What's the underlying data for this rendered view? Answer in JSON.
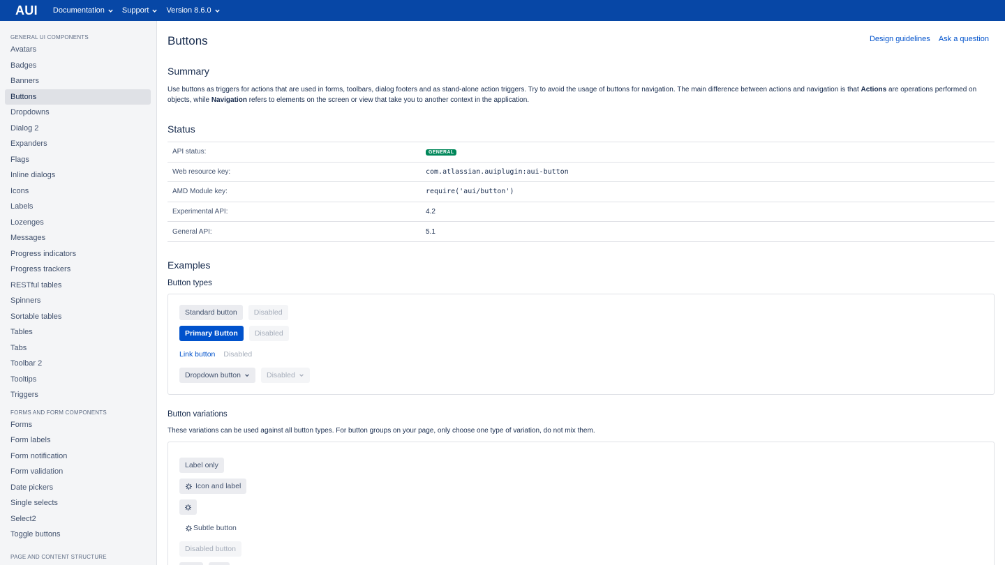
{
  "header": {
    "logo": "AUI",
    "nav": [
      {
        "label": "Documentation"
      },
      {
        "label": "Support"
      },
      {
        "label": "Version 8.6.0"
      }
    ]
  },
  "sidebar": {
    "sections": [
      {
        "heading": "GENERAL UI COMPONENTS",
        "items": [
          "Avatars",
          "Badges",
          "Banners",
          "Buttons",
          "Dropdowns",
          "Dialog 2",
          "Expanders",
          "Flags",
          "Inline dialogs",
          "Icons",
          "Labels",
          "Lozenges",
          "Messages",
          "Progress indicators",
          "Progress trackers",
          "RESTful tables",
          "Spinners",
          "Sortable tables",
          "Tables",
          "Tabs",
          "Toolbar 2",
          "Tooltips",
          "Triggers"
        ]
      },
      {
        "heading": "FORMS AND FORM COMPONENTS",
        "items": [
          "Forms",
          "Form labels",
          "Form notification",
          "Form validation",
          "Date pickers",
          "Single selects",
          "Select2",
          "Toggle buttons"
        ]
      },
      {
        "heading": "PAGE AND CONTENT STRUCTURE",
        "items": []
      }
    ],
    "active": "Buttons"
  },
  "main": {
    "title": "Buttons",
    "links": [
      "Design guidelines",
      "Ask a question"
    ],
    "summary_heading": "Summary",
    "summary_pre": "Use buttons as triggers for actions that are used in forms, toolbars, dialog footers and as stand-alone action triggers. Try to avoid the usage of buttons for navigation. The main difference between actions and navigation is that ",
    "summary_b1": "Actions",
    "summary_mid": " are operations performed on objects, while ",
    "summary_b2": "Navigation",
    "summary_post": " refers to elements on the screen or view that take you to another context in the application.",
    "status_heading": "Status",
    "status_rows": [
      {
        "label": "API status:",
        "value": "GENERAL",
        "kind": "lozenge"
      },
      {
        "label": "Web resource key:",
        "value": "com.atlassian.auiplugin:aui-button",
        "kind": "mono"
      },
      {
        "label": "AMD Module key:",
        "value": "require('aui/button')",
        "kind": "mono"
      },
      {
        "label": "Experimental API:",
        "value": "4.2",
        "kind": "text"
      },
      {
        "label": "General API:",
        "value": "5.1",
        "kind": "text"
      }
    ],
    "examples_heading": "Examples",
    "button_types_heading": "Button types",
    "button_types": {
      "standard": "Standard button",
      "standard_disabled": "Disabled",
      "primary": "Primary Button",
      "primary_disabled": "Disabled",
      "link": "Link button",
      "link_disabled": "Disabled",
      "dropdown": "Dropdown button",
      "dropdown_disabled": "Disabled"
    },
    "variations_heading": "Button variations",
    "variations_desc": "These variations can be used against all button types. For button groups on your page, only choose one type of variation, do not mix them.",
    "variations": {
      "label_only": "Label only",
      "icon_and_label": "Icon and label",
      "subtle": "Subtle button",
      "disabled": "Disabled button"
    }
  },
  "colors": {
    "header": "#0747a6",
    "primary": "#0052cc",
    "lozenge_success": "#00875a"
  }
}
